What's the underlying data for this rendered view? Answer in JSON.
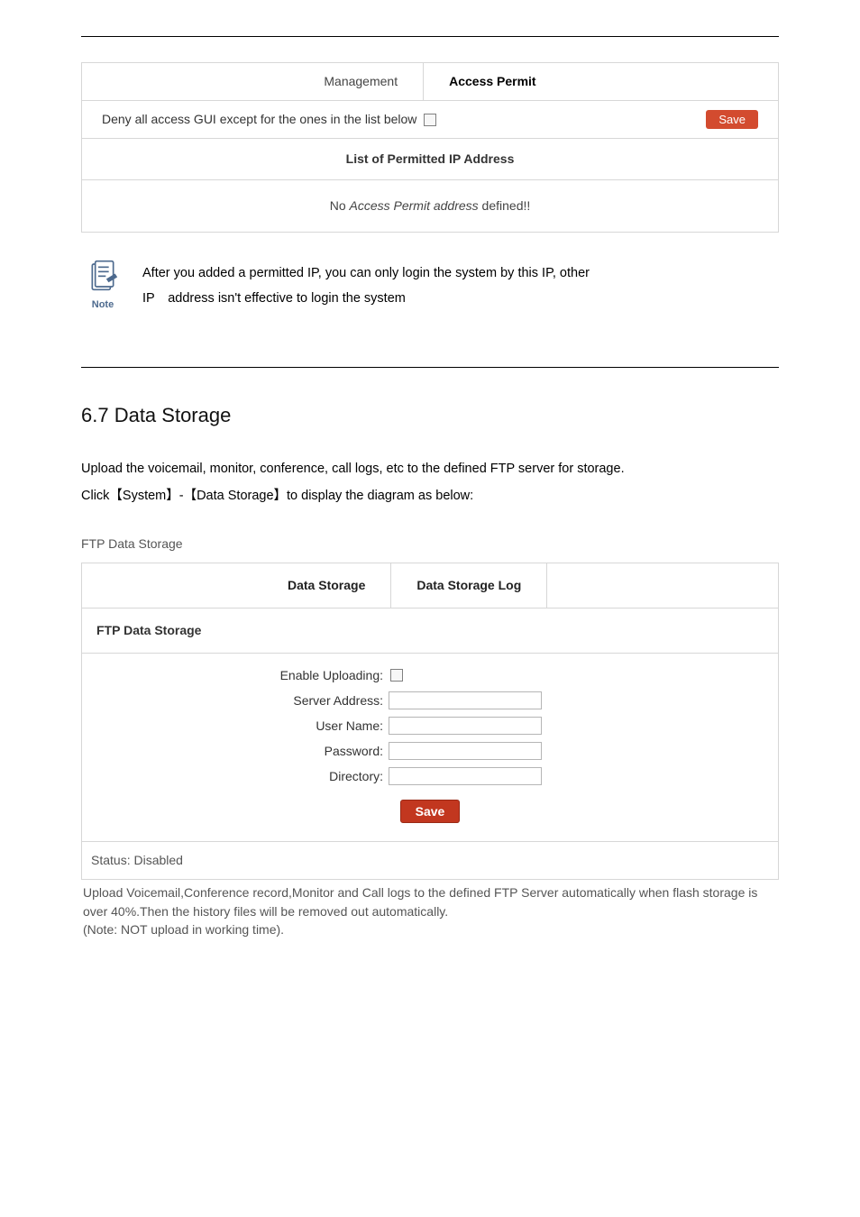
{
  "access_permit": {
    "tabs": {
      "management": "Management",
      "access_permit": "Access Permit"
    },
    "deny_label": "Deny all access GUI except for the ones in the list below",
    "save_label": "Save",
    "list_header": "List of Permitted IP Address",
    "empty_prefix": "No ",
    "empty_italic": "Access Permit address",
    "empty_suffix": " defined!!"
  },
  "note": {
    "icon_label": "Note",
    "line1": "After you added a permitted IP, you can only login the system by this IP, other",
    "line2": "IP address isn't effective to login the system"
  },
  "section": {
    "heading": "6.7 Data Storage",
    "para1": "Upload the voicemail, monitor, conference, call logs, etc to the defined FTP server for storage.",
    "para2": "Click【System】-【Data Storage】to display the diagram as below:"
  },
  "ftp": {
    "caption": "FTP Data Storage",
    "tabs": {
      "data_storage": "Data Storage",
      "data_storage_log": "Data Storage Log"
    },
    "group_header": "FTP Data Storage",
    "labels": {
      "enable": "Enable Uploading:",
      "server": "Server Address:",
      "user": "User Name:",
      "password": "Password:",
      "directory": "Directory:"
    },
    "save_label": "Save",
    "status": "Status:  Disabled",
    "footer1": "Upload Voicemail,Conference record,Monitor and Call logs to the defined FTP Server automatically when flash storage is over 40%.Then the history files will be removed out automatically.",
    "footer2": "(Note: NOT upload in working time)."
  }
}
